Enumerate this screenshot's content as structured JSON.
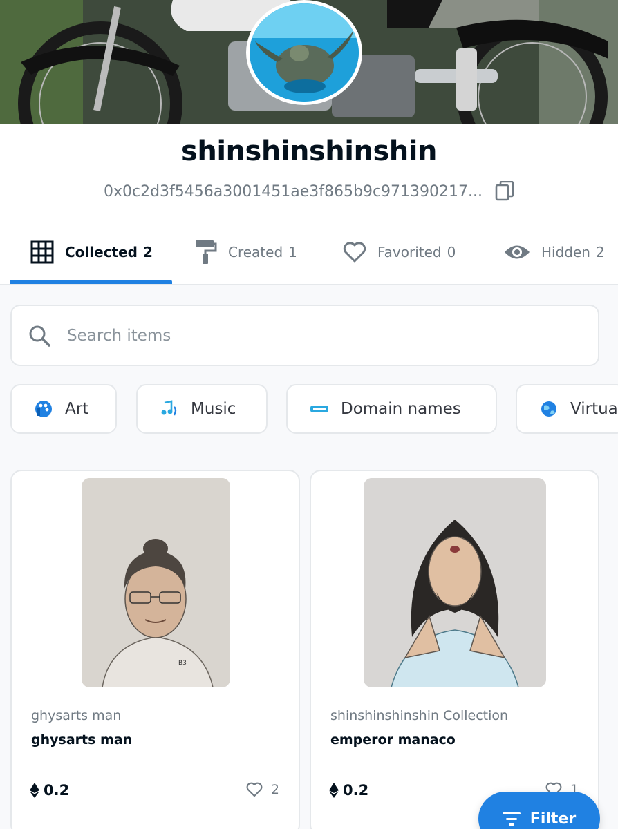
{
  "profile": {
    "username": "shinshinshinshin",
    "address": "0x0c2d3f5456a3001451ae3f865b9c971390217...",
    "banner_icon": "motorcycle-banner-image",
    "avatar_icon": "sea-turtle-avatar-image"
  },
  "tabs": [
    {
      "label": "Collected",
      "count": "2",
      "icon": "grid-icon",
      "active": true
    },
    {
      "label": "Created",
      "count": "1",
      "icon": "paint-roller-icon",
      "active": false
    },
    {
      "label": "Favorited",
      "count": "0",
      "icon": "heart-icon",
      "active": false
    },
    {
      "label": "Hidden",
      "count": "2",
      "icon": "eye-icon",
      "active": false
    }
  ],
  "search": {
    "placeholder": "Search items"
  },
  "categories": [
    {
      "label": "Art",
      "icon": "art-icon"
    },
    {
      "label": "Music",
      "icon": "music-icon"
    },
    {
      "label": "Domain names",
      "icon": "domain-names-icon"
    },
    {
      "label": "Virtua",
      "icon": "virtual-worlds-icon"
    }
  ],
  "items": [
    {
      "collection": "ghysarts man",
      "name": "ghysarts man",
      "price": "0.2",
      "likes": "2",
      "image_signature": "B3"
    },
    {
      "collection": "shinshinshinshin Collection",
      "name": "emperor manaco",
      "price": "0.2",
      "likes": "1"
    }
  ],
  "filter_button": {
    "label": "Filter"
  },
  "colors": {
    "accent": "#2081e2",
    "text": "#04111d",
    "muted": "#707a83",
    "border": "#e5e8eb"
  }
}
